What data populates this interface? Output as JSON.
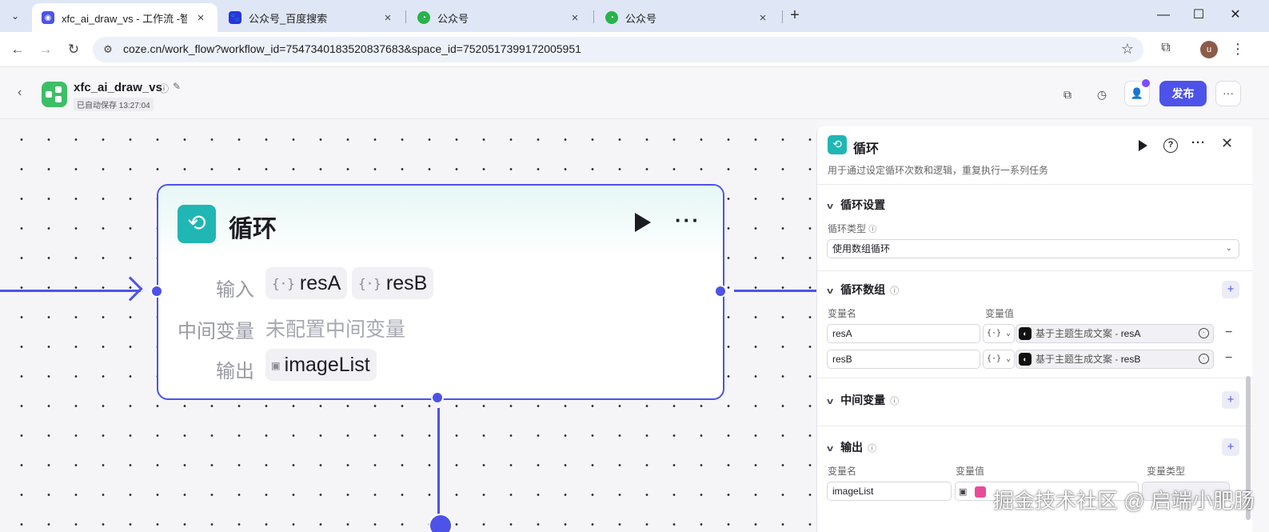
{
  "browser": {
    "tabs": [
      {
        "title": "xfc_ai_draw_vs - 工作流 -智能",
        "close": "×"
      },
      {
        "title": "公众号_百度搜索",
        "close": "×"
      },
      {
        "title": "公众号",
        "close": "×"
      },
      {
        "title": "公众号",
        "close": "×"
      }
    ],
    "url": "coze.cn/work_flow?workflow_id=7547340183520837683&space_id=7520517399172005951",
    "avatar_letter": "u"
  },
  "app": {
    "name": "xfc_ai_draw_vs",
    "autosave": "已自动保存 13:27:04",
    "publish_label": "发布"
  },
  "node": {
    "title": "循环",
    "input_label": "输入",
    "inputs": [
      "resA",
      "resB"
    ],
    "intermediate_label": "中间变量",
    "intermediate_value": "未配置中间变量",
    "output_label": "输出",
    "output": "imageList"
  },
  "panel": {
    "title": "循环",
    "description": "用于通过设定循环次数和逻辑，重复执行一系列任务",
    "loop_settings": {
      "title": "循环设置",
      "type_label": "循环类型",
      "type_value": "使用数组循环"
    },
    "loop_array": {
      "title": "循环数组",
      "col_name": "变量名",
      "col_value": "变量值",
      "rows": [
        {
          "name": "resA",
          "type": "{·}",
          "source": "基于主题生成文案 -",
          "var": "resA"
        },
        {
          "name": "resB",
          "type": "{·}",
          "source": "基于主题生成文案 -",
          "var": "resB"
        }
      ]
    },
    "intermediate": {
      "title": "中间变量"
    },
    "output": {
      "title": "输出",
      "col_name": "变量名",
      "col_value": "变量值",
      "col_type": "变量类型",
      "rows": [
        {
          "name": "imageList"
        }
      ]
    }
  },
  "watermark": "掘金技术社区 @ 启端小肥肠",
  "colors": {
    "accent": "#4d53e8",
    "loop_icon": "#1fb6b4",
    "app_logo": "#3dbf66"
  }
}
